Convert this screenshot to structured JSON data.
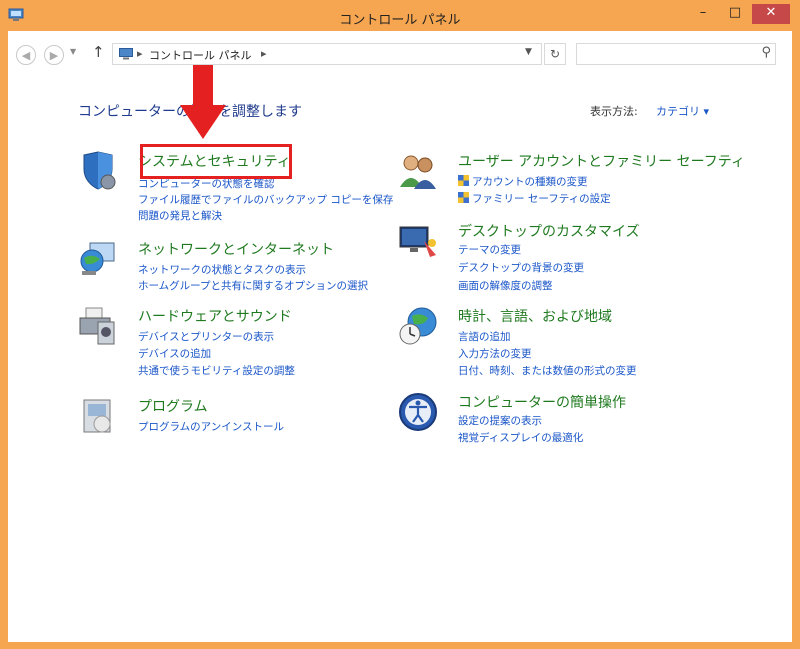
{
  "window": {
    "title": "コントロール パネル",
    "controls": {
      "minimize": "–",
      "maximize": "□",
      "close": "✕"
    }
  },
  "address_bar": {
    "breadcrumbs": [
      "コントロール パネル"
    ],
    "search_placeholder": ""
  },
  "main": {
    "heading": "コンピューターの設定を調整します",
    "view_by_label": "表示方法:",
    "view_by_value": "カテゴリ ▾"
  },
  "categories": [
    {
      "id": "system-security",
      "title": "システムとセキュリティ",
      "links": [
        "コンピューターの状態を確認",
        "ファイル履歴でファイルのバックアップ コピーを保存",
        "問題の発見と解決"
      ]
    },
    {
      "id": "network-internet",
      "title": "ネットワークとインターネット",
      "links": [
        "ネットワークの状態とタスクの表示",
        "ホームグループと共有に関するオプションの選択"
      ]
    },
    {
      "id": "hardware-sound",
      "title": "ハードウェアとサウンド",
      "links": [
        "デバイスとプリンターの表示",
        "デバイスの追加",
        "共通で使うモビリティ設定の調整"
      ]
    },
    {
      "id": "programs",
      "title": "プログラム",
      "links": [
        "プログラムのアンインストール"
      ]
    },
    {
      "id": "user-accounts",
      "title": "ユーザー アカウントとファミリー セーフティ",
      "links": [
        "アカウントの種類の変更",
        "ファミリー セーフティの設定"
      ]
    },
    {
      "id": "appearance",
      "title": "デスクトップのカスタマイズ",
      "links": [
        "テーマの変更",
        "デスクトップの背景の変更",
        "画面の解像度の調整"
      ]
    },
    {
      "id": "clock-region",
      "title": "時計、言語、および地域",
      "links": [
        "言語の追加",
        "入力方法の変更",
        "日付、時刻、または数値の形式の変更"
      ]
    },
    {
      "id": "ease-of-access",
      "title": "コンピューターの簡単操作",
      "links": [
        "設定の提案の表示",
        "視覚ディスプレイの最適化"
      ]
    }
  ],
  "colors": {
    "frame": "#f6a650",
    "category_title": "#1f7a1f",
    "link": "#1a56c8",
    "highlight": "#e52020"
  }
}
